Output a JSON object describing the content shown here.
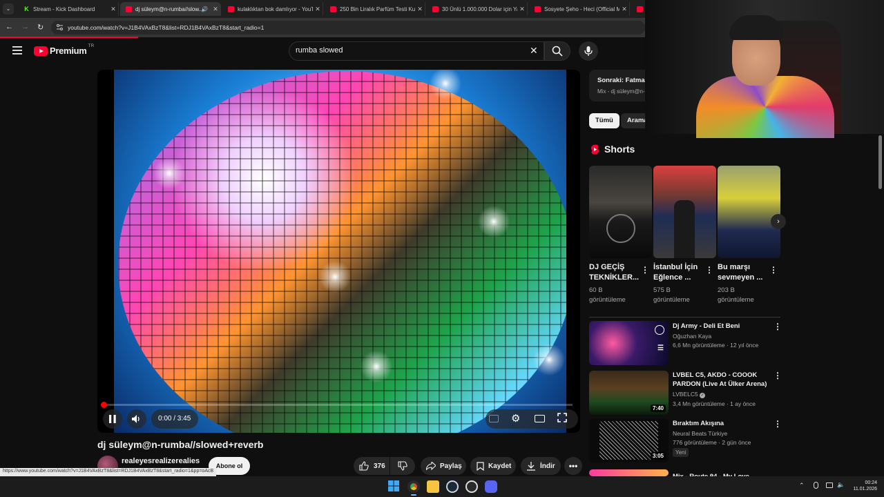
{
  "browser": {
    "tabs": [
      {
        "label": "Stream - Kick Dashboard",
        "type": "kick"
      },
      {
        "label": "dj süleym@n-rumba//slow...",
        "type": "yt",
        "active": true
      },
      {
        "label": "kulaklıktan bok damlıyor - YouTube",
        "type": "yt"
      },
      {
        "label": "250 Bin Liralık Parfüm Testi Kuli...",
        "type": "yt"
      },
      {
        "label": "30 Ünlü 1.000.000 Dolar için Yar...",
        "type": "yt"
      },
      {
        "label": "Sosyete Şeho - Heci (Official Mu...",
        "type": "yt"
      }
    ],
    "url": "youtube.com/watch?v=J1B4VAxBzT8&list=RDJ1B4VAxBzT8&start_radio=1",
    "status_url": "https://www.youtube.com/watch?v=J1B4VAxBzT8&list=RDJ1B4VAxBzT8&start_radio=1&pp=oAcB"
  },
  "header": {
    "logo_text": "Premium",
    "region": "TR",
    "search_value": "rumba slowed"
  },
  "player": {
    "time": "0:00 / 3:45",
    "progress_fraction": 0.0
  },
  "video": {
    "title": "dj süleym@n-rumba//slowed+reverb",
    "channel": "realeyesrealizerealies",
    "subscribe_label": "Abone ol",
    "likes": "376",
    "share_label": "Paylaş",
    "save_label": "Kaydet",
    "download_label": "İndir"
  },
  "sidebar": {
    "next_label": "Sonraki: Fatma I",
    "next_sub": "Mix - dj süleym@n-",
    "chips": [
      "Tümü",
      "Arama"
    ],
    "shorts_heading": "Shorts",
    "shorts": [
      {
        "title": "DJ GEÇİŞ TEKNİKLER...",
        "views": "60 B",
        "views_suffix": "görüntüleme"
      },
      {
        "title": "İstanbul İçin Eğlence ...",
        "views": "575 B",
        "views_suffix": "görüntüleme"
      },
      {
        "title": "Bu marşı sevmeyen ...",
        "views": "203 B",
        "views_suffix": "görüntüleme"
      }
    ],
    "related": [
      {
        "title": "Dj Army - Deli Et Beni",
        "channel": "Oğuzhan Kaya",
        "meta": "6,6 Mn görüntüleme · 12 yıl önce",
        "duration": ""
      },
      {
        "title": "LVBEL C5, AKDO - COOOK PARDON (Live At Ülker Arena)",
        "channel": "LVBELC5",
        "meta": "3,4 Mn görüntüleme · 1 ay önce",
        "duration": "7:40"
      },
      {
        "title": "Bıraktım Akışına",
        "channel": "Neural Beats Türkiye",
        "meta": "776 görüntüleme · 2 gün önce",
        "badge": "Yeni",
        "duration": "3:05"
      },
      {
        "title": "Mix - Route 94 - My Love",
        "channel": "",
        "meta": "",
        "duration": ""
      }
    ]
  },
  "taskbar": {
    "time": "00:24",
    "date": "11.01.2026"
  }
}
